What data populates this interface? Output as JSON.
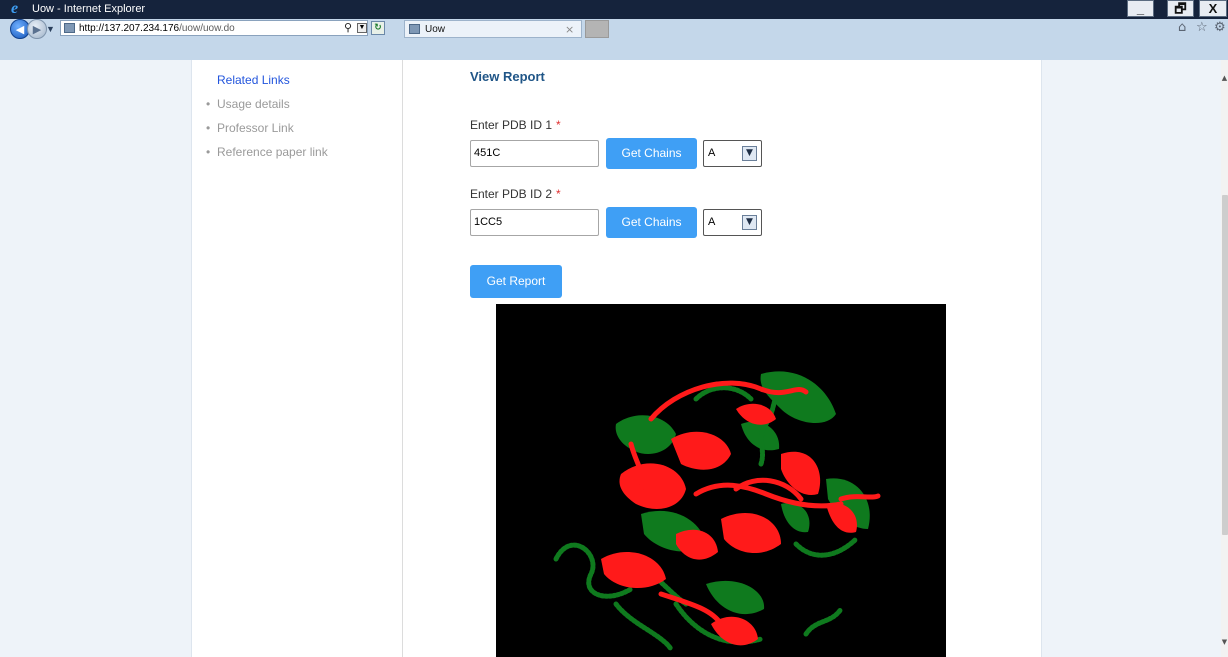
{
  "window": {
    "title": "Uow - Internet Explorer",
    "controls": {
      "minimize": "_",
      "restore": "🗗",
      "close": "X"
    }
  },
  "browser": {
    "url_host": "http://137.207.234.176",
    "url_path": "/uow/uow.do",
    "tab_label": "Uow",
    "tab_close": "×",
    "icons": [
      "back-icon",
      "forward-icon",
      "search-icon",
      "refresh-icon",
      "home-icon",
      "favorites-star-icon",
      "tools-gear-icon"
    ]
  },
  "sidebar": {
    "heading": "Related Links",
    "items": [
      {
        "label": "Usage details"
      },
      {
        "label": "Professor Link"
      },
      {
        "label": "Reference paper link"
      }
    ]
  },
  "main": {
    "section_title": "View Report",
    "pdb1": {
      "label": "Enter PDB ID 1",
      "required": "*",
      "value": "451C",
      "chain": "A"
    },
    "pdb2": {
      "label": "Enter PDB ID 2",
      "required": "*",
      "value": "1CC5",
      "chain": "A"
    },
    "get_chains_label": "Get Chains",
    "get_report_label": "Get Report"
  },
  "viewer": {
    "background": "#000000",
    "structure_colors": {
      "protein_1": "#ff1a1a",
      "protein_2": "#0f7a1e"
    }
  },
  "colors": {
    "accent_button": "#3f9ff5",
    "link_blue": "#2255dd",
    "title_blue": "#1f5587",
    "required_red": "#e03030"
  }
}
